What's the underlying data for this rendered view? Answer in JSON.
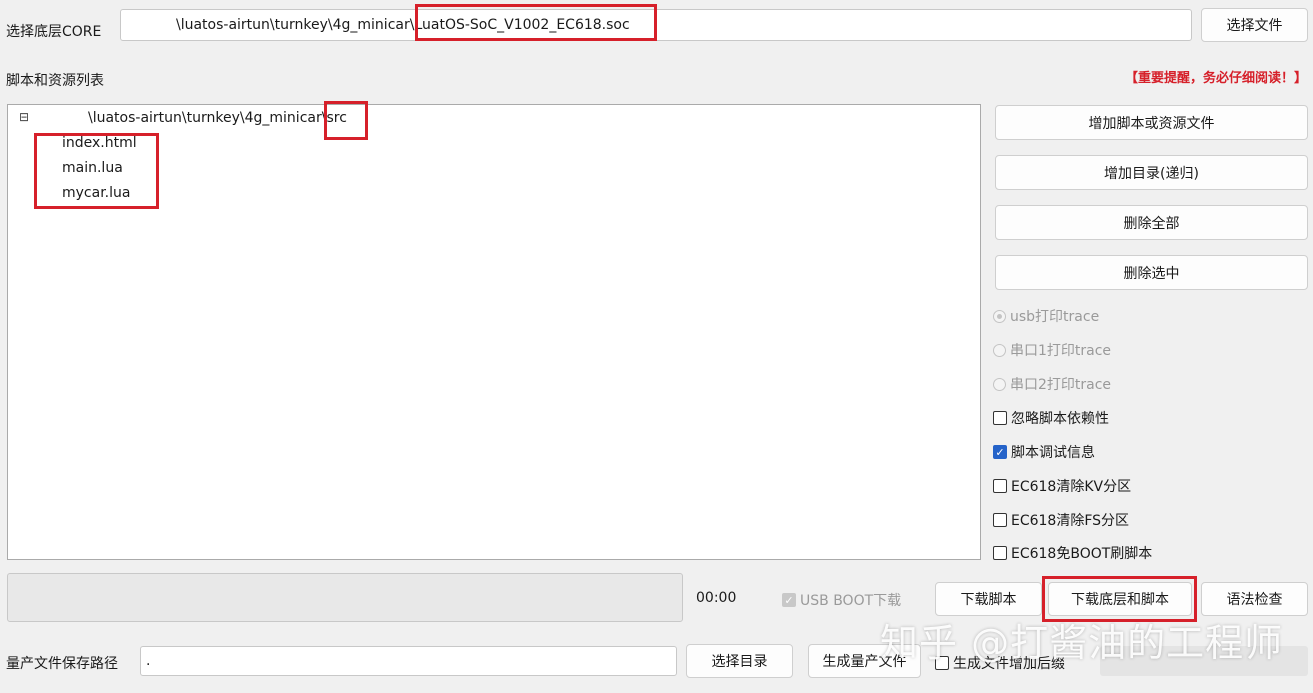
{
  "core": {
    "label": "选择底层CORE",
    "path_dir": "\\luatos-airtun\\turnkey\\4g_minicar",
    "path_file": "\\LuatOS-SoC_V1002_EC618.soc",
    "select_button": "选择文件"
  },
  "script_list": {
    "label": "脚本和资源列表",
    "notice": "【重要提醒，务必仔细阅读！】",
    "tree": {
      "expander": "⊟",
      "root_dir": "\\luatos-airtun\\turnkey\\4g_minicar",
      "root_folder": "\\src",
      "files": [
        "index.html",
        "main.lua",
        "mycar.lua"
      ]
    }
  },
  "side_buttons": {
    "add_script": "增加脚本或资源文件",
    "add_dir": "增加目录(递归)",
    "delete_all": "删除全部",
    "delete_selected": "删除选中"
  },
  "trace_options": [
    {
      "label": "usb打印trace",
      "selected": true
    },
    {
      "label": "串口1打印trace",
      "selected": false
    },
    {
      "label": "串口2打印trace",
      "selected": false
    }
  ],
  "check_options": [
    {
      "label": "忽略脚本依赖性",
      "checked": false
    },
    {
      "label": "脚本调试信息",
      "checked": true
    },
    {
      "label": "EC618清除KV分区",
      "checked": false
    },
    {
      "label": "EC618清除FS分区",
      "checked": false
    },
    {
      "label": "EC618免BOOT刷脚本",
      "checked": false
    }
  ],
  "bottom": {
    "timer": "00:00",
    "usb_boot": "USB BOOT下载",
    "download_script": "下载脚本",
    "download_core_and_script": "下载底层和脚本",
    "syntax_check": "语法检查"
  },
  "production": {
    "label": "量产文件保存路径",
    "path_value": ".",
    "select_dir": "选择目录",
    "generate": "生成量产文件",
    "suffix_option": "生成文件增加后缀"
  },
  "watermark": "知乎 @打酱油的工程师",
  "colors": {
    "highlight": "#d6202a",
    "notice": "#d6202a",
    "check_on": "#2563c9"
  }
}
